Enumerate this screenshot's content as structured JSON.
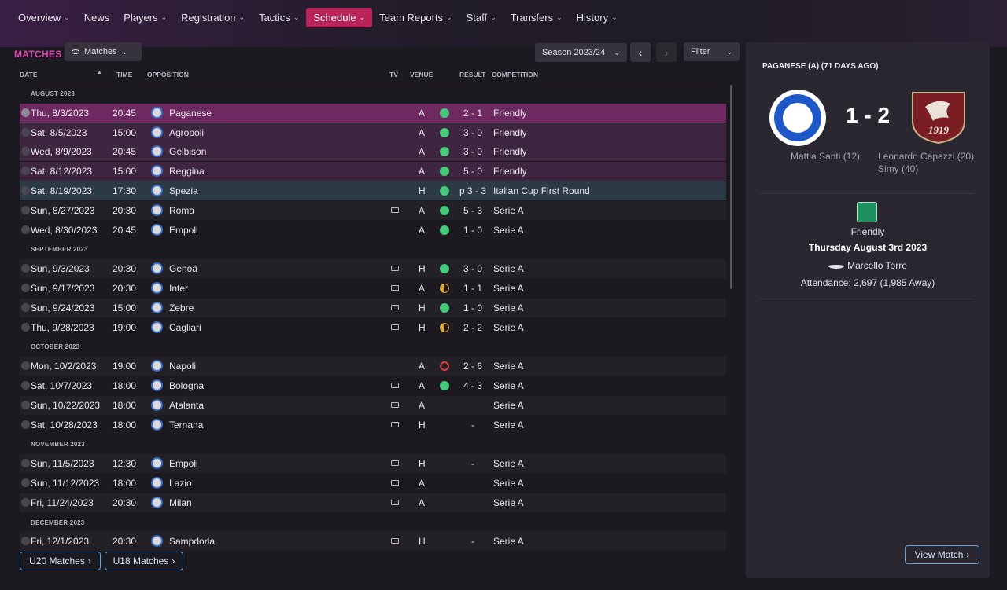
{
  "nav": {
    "items": [
      {
        "label": "Overview",
        "chevron": true
      },
      {
        "label": "News",
        "chevron": false
      },
      {
        "label": "Players",
        "chevron": true
      },
      {
        "label": "Registration",
        "chevron": true
      },
      {
        "label": "Tactics",
        "chevron": true
      },
      {
        "label": "Schedule",
        "chevron": true,
        "active": true
      },
      {
        "label": "Team Reports",
        "chevron": true
      },
      {
        "label": "Staff",
        "chevron": true
      },
      {
        "label": "Transfers",
        "chevron": true
      },
      {
        "label": "History",
        "chevron": true
      }
    ]
  },
  "toolbar": {
    "section_title": "MATCHES",
    "view_label": "Matches",
    "season_label": "Season 2023/24",
    "filter_label": "Filter"
  },
  "columns": {
    "date": "DATE",
    "time": "TIME",
    "opposition": "OPPOSITION",
    "tv": "TV",
    "venue": "VENUE",
    "result": "RESULT",
    "competition": "COMPETITION"
  },
  "schedule": [
    {
      "month": "AUGUST 2023"
    },
    {
      "date": "Thu, 8/3/2023",
      "time": "20:45",
      "opp": "Paganese",
      "tv": false,
      "venue": "A",
      "res": "win",
      "score": "2 - 1",
      "comp": "Friendly",
      "style": "hl1",
      "played": true
    },
    {
      "date": "Sat, 8/5/2023",
      "time": "15:00",
      "opp": "Agropoli",
      "tv": false,
      "venue": "A",
      "res": "win",
      "score": "3 - 0",
      "comp": "Friendly",
      "style": "hl2",
      "played": true
    },
    {
      "date": "Wed, 8/9/2023",
      "time": "20:45",
      "opp": "Gelbison",
      "tv": false,
      "venue": "A",
      "res": "win",
      "score": "3 - 0",
      "comp": "Friendly",
      "style": "hl2",
      "played": true
    },
    {
      "date": "Sat, 8/12/2023",
      "time": "15:00",
      "opp": "Reggina",
      "tv": false,
      "venue": "A",
      "res": "win",
      "score": "5 - 0",
      "comp": "Friendly",
      "style": "hl2",
      "played": true
    },
    {
      "date": "Sat, 8/19/2023",
      "time": "17:30",
      "opp": "Spezia",
      "tv": false,
      "venue": "H",
      "res": "win",
      "score": "p 3 - 3",
      "comp": "Italian Cup First Round",
      "style": "hl3",
      "played": true
    },
    {
      "date": "Sun, 8/27/2023",
      "time": "20:30",
      "opp": "Roma",
      "tv": true,
      "venue": "A",
      "res": "win",
      "score": "5 - 3",
      "comp": "Serie A",
      "style": "even",
      "played": true
    },
    {
      "date": "Wed, 8/30/2023",
      "time": "20:45",
      "opp": "Empoli",
      "tv": false,
      "venue": "A",
      "res": "win",
      "score": "1 - 0",
      "comp": "Serie A",
      "style": "odd",
      "played": true
    },
    {
      "month": "SEPTEMBER 2023"
    },
    {
      "date": "Sun, 9/3/2023",
      "time": "20:30",
      "opp": "Genoa",
      "tv": true,
      "venue": "H",
      "res": "win",
      "score": "3 - 0",
      "comp": "Serie A",
      "style": "even",
      "played": true
    },
    {
      "date": "Sun, 9/17/2023",
      "time": "20:30",
      "opp": "Inter",
      "tv": true,
      "venue": "A",
      "res": "draw",
      "score": "1 - 1",
      "comp": "Serie A",
      "style": "odd",
      "played": true
    },
    {
      "date": "Sun, 9/24/2023",
      "time": "15:00",
      "opp": "Zebre",
      "tv": true,
      "venue": "H",
      "res": "win",
      "score": "1 - 0",
      "comp": "Serie A",
      "style": "even",
      "played": true
    },
    {
      "date": "Thu, 9/28/2023",
      "time": "19:00",
      "opp": "Cagliari",
      "tv": true,
      "venue": "H",
      "res": "draw",
      "score": "2 - 2",
      "comp": "Serie A",
      "style": "odd",
      "played": true
    },
    {
      "month": "OCTOBER 2023"
    },
    {
      "date": "Mon, 10/2/2023",
      "time": "19:00",
      "opp": "Napoli",
      "tv": false,
      "venue": "A",
      "res": "loss",
      "score": "2 - 6",
      "comp": "Serie A",
      "style": "even",
      "played": true
    },
    {
      "date": "Sat, 10/7/2023",
      "time": "18:00",
      "opp": "Bologna",
      "tv": true,
      "venue": "A",
      "res": "win",
      "score": "4 - 3",
      "comp": "Serie A",
      "style": "odd",
      "played": true
    },
    {
      "date": "Sun, 10/22/2023",
      "time": "18:00",
      "opp": "Atalanta",
      "tv": true,
      "venue": "A",
      "res": "",
      "score": "",
      "comp": "Serie A",
      "style": "even",
      "played": false
    },
    {
      "date": "Sat, 10/28/2023",
      "time": "18:00",
      "opp": "Ternana",
      "tv": true,
      "venue": "H",
      "res": "",
      "score": "-",
      "comp": "Serie A",
      "style": "odd",
      "played": false
    },
    {
      "month": "NOVEMBER 2023"
    },
    {
      "date": "Sun, 11/5/2023",
      "time": "12:30",
      "opp": "Empoli",
      "tv": true,
      "venue": "H",
      "res": "",
      "score": "-",
      "comp": "Serie A",
      "style": "even",
      "played": false
    },
    {
      "date": "Sun, 11/12/2023",
      "time": "18:00",
      "opp": "Lazio",
      "tv": true,
      "venue": "A",
      "res": "",
      "score": "",
      "comp": "Serie A",
      "style": "odd",
      "played": false
    },
    {
      "date": "Fri, 11/24/2023",
      "time": "20:30",
      "opp": "Milan",
      "tv": true,
      "venue": "A",
      "res": "",
      "score": "",
      "comp": "Serie A",
      "style": "even",
      "played": false
    },
    {
      "month": "DECEMBER 2023"
    },
    {
      "date": "Fri, 12/1/2023",
      "time": "20:30",
      "opp": "Sampdoria",
      "tv": true,
      "venue": "H",
      "res": "",
      "score": "-",
      "comp": "Serie A",
      "style": "even",
      "played": false
    }
  ],
  "footer": {
    "u20": "U20 Matches",
    "u18": "U18 Matches"
  },
  "panel": {
    "title": "PAGANESE (A) (71 DAYS AGO)",
    "score": "1 - 2",
    "home_scorers": "Mattia Santi (12)",
    "away_scorers_1": "Leonardo Capezzi (20)",
    "away_scorers_2": "Simy (40)",
    "away_crest_text": "1919",
    "competition": "Friendly",
    "date": "Thursday August 3rd 2023",
    "stadium": "Marcello Torre",
    "attendance": "Attendance: 2,697 (1,985 Away)",
    "view_button": "View Match"
  },
  "colors": {
    "accent": "#b8245a",
    "title": "#e046b2",
    "win": "#47c97a",
    "draw": "#e0a83a",
    "loss": "#d94040",
    "button_border": "#6fa3d8"
  }
}
